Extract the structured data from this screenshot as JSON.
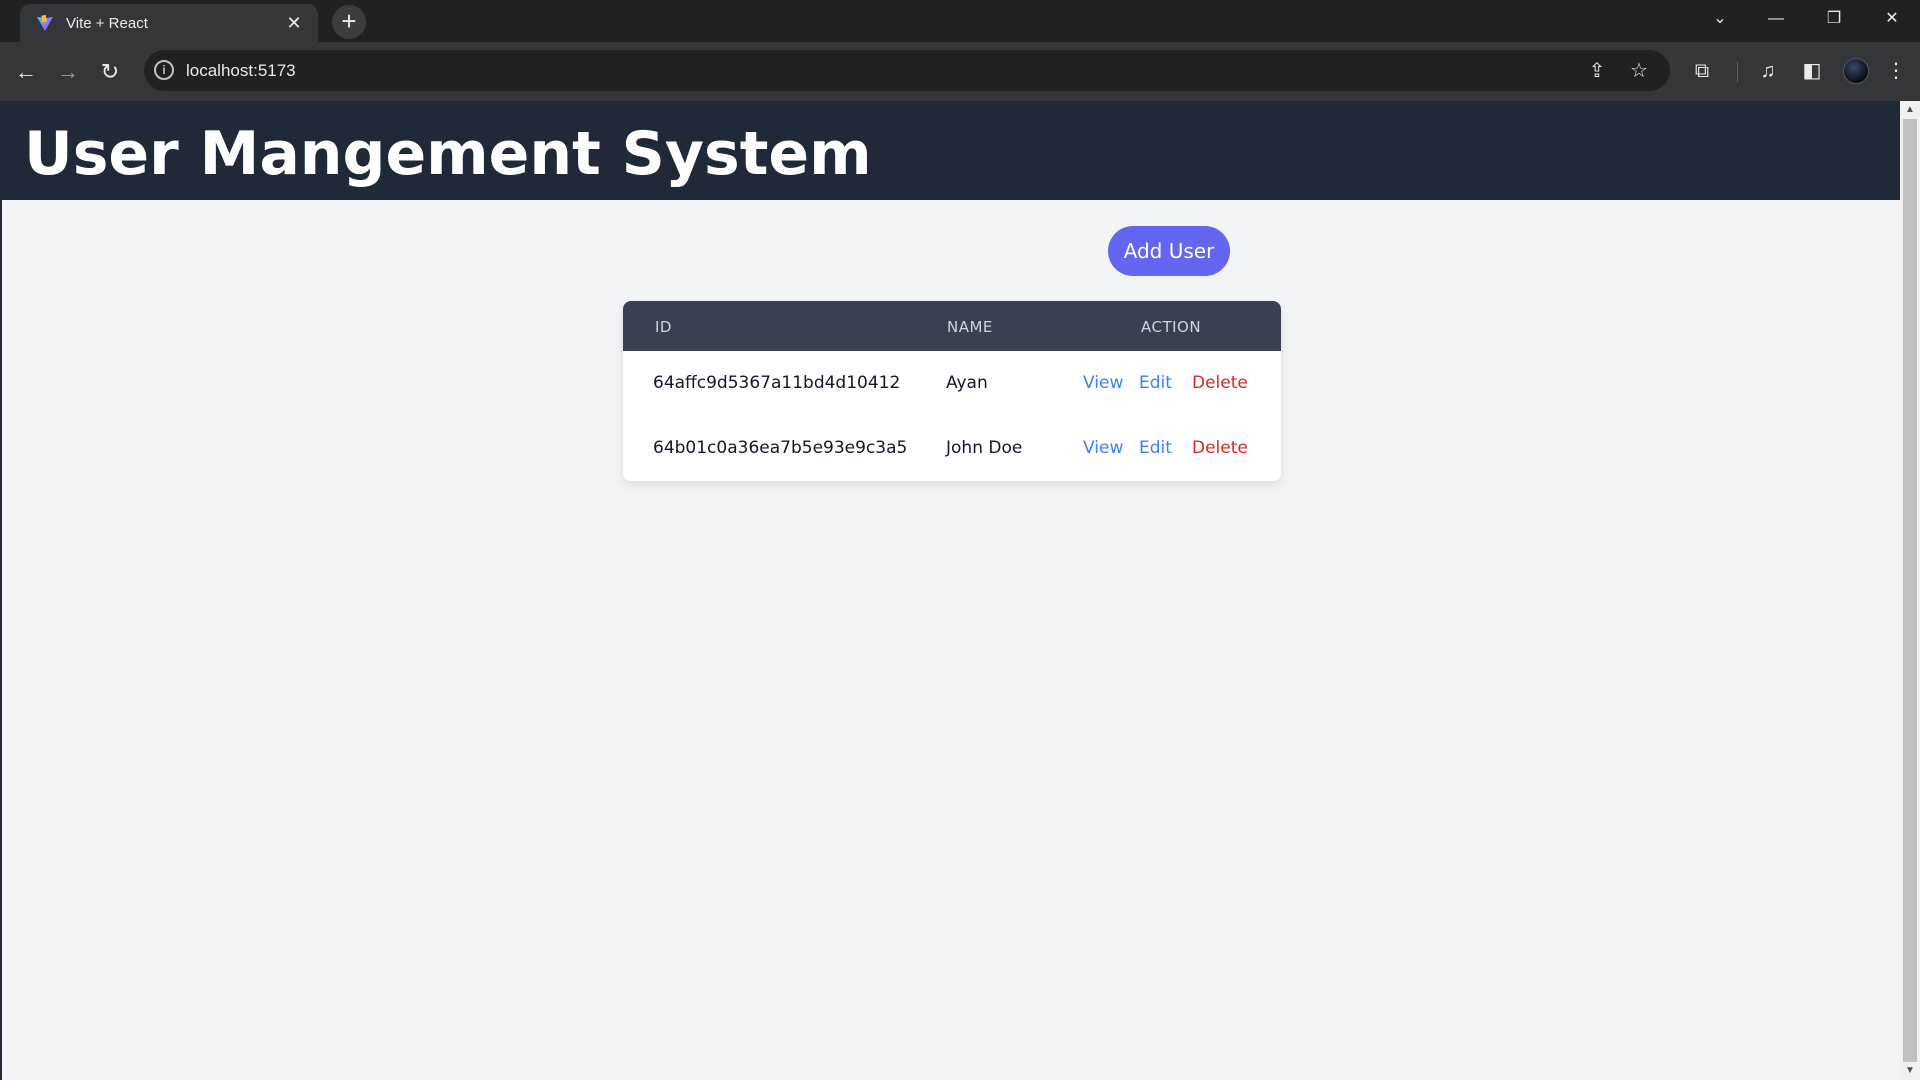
{
  "browser": {
    "tab_title": "Vite + React",
    "url": "localhost:5173",
    "icons": {
      "favicon": "vite-logo-icon",
      "tab_close": "close-icon",
      "new_tab": "plus-icon",
      "tab_search": "chevron-down-icon",
      "minimize": "minimize-icon",
      "restore": "restore-icon",
      "close_window": "close-icon",
      "back": "arrow-left-icon",
      "forward": "arrow-right-icon",
      "reload": "reload-icon",
      "site_info": "info-icon",
      "share": "share-icon",
      "bookmark": "star-icon",
      "extensions": "puzzle-icon",
      "media": "media-icon",
      "side_panel": "side-panel-icon",
      "menu": "kebab-menu-icon"
    }
  },
  "app": {
    "title": "User Mangement System",
    "add_button_label": "Add User",
    "accent_color": "#6366f1",
    "header_color": "#1f2937",
    "table": {
      "headers": {
        "id": "ID",
        "name": "NAME",
        "action": "ACTION"
      },
      "rows": [
        {
          "id": "64affc9d5367a11bd4d10412",
          "name": "Ayan",
          "view": "View",
          "edit": "Edit",
          "delete": "Delete"
        },
        {
          "id": "64b01c0a36ea7b5e93e9c3a5",
          "name": "John Doe",
          "view": "View",
          "edit": "Edit",
          "delete": "Delete"
        }
      ]
    }
  }
}
